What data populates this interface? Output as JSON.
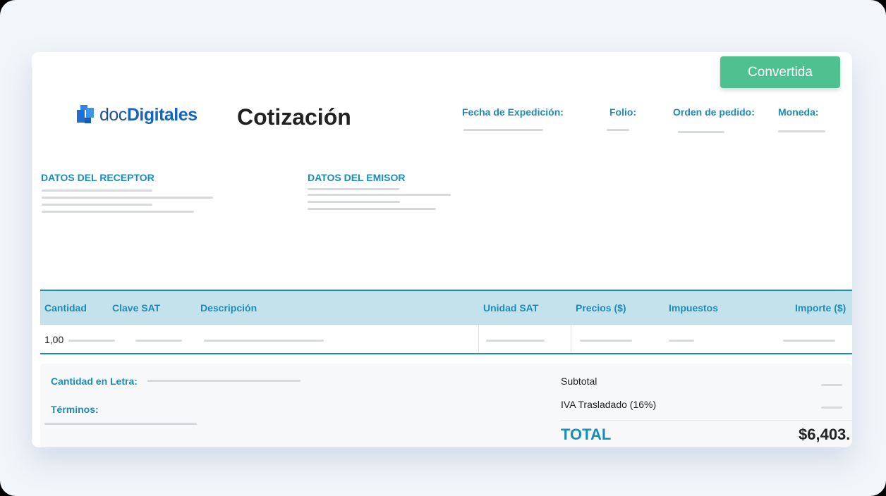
{
  "status": {
    "label": "Convertida",
    "color": "#4fc08f"
  },
  "brand": {
    "name_prefix": "doc",
    "name_bold": "Digitales",
    "icon": "document-stack-logo-icon"
  },
  "document": {
    "title": "Cotización"
  },
  "meta": {
    "issue_date_label": "Fecha de Expedición:",
    "folio_label": "Folio:",
    "order_label": "Orden de pedido:",
    "currency_label": "Moneda:"
  },
  "receiver": {
    "title": "DATOS DEL RECEPTOR"
  },
  "issuer": {
    "title": "DATOS DEL EMISOR"
  },
  "table": {
    "headers": [
      "Cantidad",
      "Clave SAT",
      "Descripción",
      "Unidad SAT",
      "Precios ($)",
      "Impuestos",
      "Importe ($)"
    ],
    "rows": [
      {
        "quantity": "1,00"
      }
    ]
  },
  "footer": {
    "amount_in_words_label": "Cantidad en Letra:",
    "terms_label": "Términos:",
    "subtotal_label": "Subtotal",
    "tax_label": "IVA Trasladado (16%)",
    "total_label": "TOTAL",
    "total_value": "$6,403."
  },
  "colors": {
    "accent": "#1a8cb8",
    "header_bg": "#c4e2ec",
    "brand_blue": "#1565c0"
  }
}
